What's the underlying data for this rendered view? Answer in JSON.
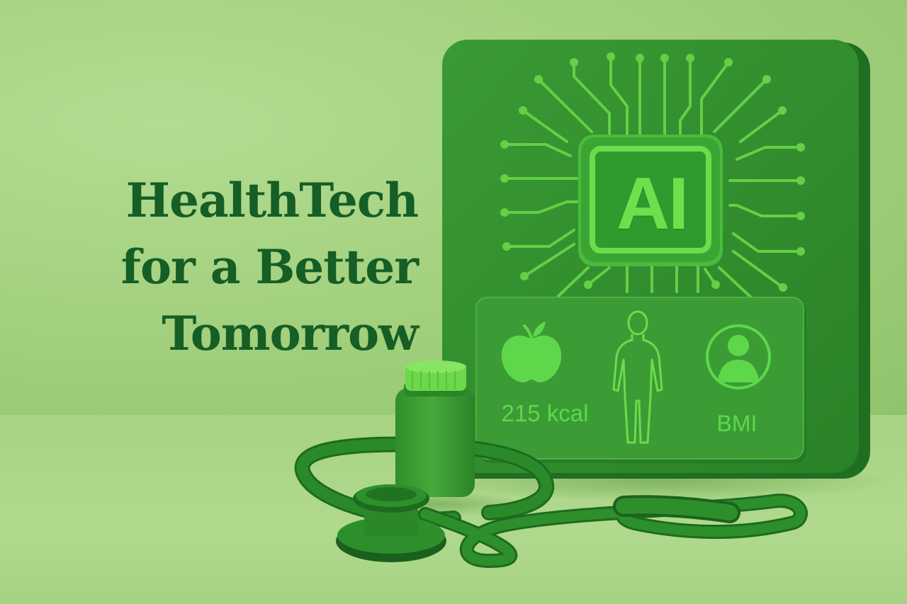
{
  "headline": {
    "line1": "HealthTech",
    "line2": "for a Better",
    "line3": "Tomorrow"
  },
  "panel": {
    "chip_label": "AI",
    "calories": "215 kcal",
    "bmi_label": "BMI"
  },
  "icons": [
    "apple-icon",
    "body-outline-icon",
    "person-avatar-icon",
    "circuit-chip-icon",
    "stethoscope-icon",
    "pill-bottle-icon"
  ],
  "colors": {
    "background": "#a6d282",
    "headline": "#155e26",
    "panel": "#2e8b2c",
    "accent": "#5ed84a"
  }
}
